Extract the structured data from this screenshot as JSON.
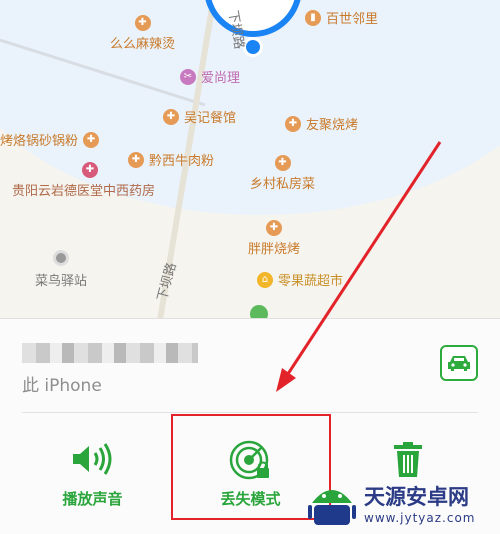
{
  "map": {
    "pois": [
      {
        "name": "百世邻里",
        "type": "food",
        "icon": "store-icon"
      },
      {
        "name": "么么麻辣烫",
        "type": "food",
        "icon": "restaurant-icon"
      },
      {
        "name": "爱尚理",
        "type": "shop",
        "icon": "salon-icon"
      },
      {
        "name": "吴记餐馆",
        "type": "food",
        "icon": "restaurant-icon"
      },
      {
        "name": "友聚烧烤",
        "type": "food",
        "icon": "restaurant-icon"
      },
      {
        "name": "烤烙锅砂锅粉",
        "type": "food",
        "icon": "restaurant-icon"
      },
      {
        "name": "黔西牛肉粉",
        "type": "food",
        "icon": "restaurant-icon"
      },
      {
        "name": "贵阳云岩德医堂中西药房",
        "type": "med",
        "icon": "pharmacy-icon"
      },
      {
        "name": "乡村私房菜",
        "type": "food",
        "icon": "restaurant-icon"
      },
      {
        "name": "菜鸟驿站",
        "type": "gray",
        "icon": "pin-icon"
      },
      {
        "name": "胖胖烧烤",
        "type": "food",
        "icon": "restaurant-icon"
      },
      {
        "name": "零果蔬超市",
        "type": "yellowshop",
        "icon": "basket-icon"
      }
    ],
    "roads": [
      "下坝路",
      "下坝路"
    ]
  },
  "sheet": {
    "device_subtitle": "此 iPhone",
    "actions": [
      {
        "label": "播放声音",
        "icon": "speaker-icon"
      },
      {
        "label": "丢失模式",
        "icon": "lost-mode-radar-icon"
      },
      {
        "label": "",
        "icon": "trash-icon"
      }
    ]
  },
  "watermark": {
    "cn": "天源安卓网",
    "en": "www.jytyaz.com"
  },
  "colors": {
    "accent": "#2aa53b",
    "highlight": "#e2232a",
    "arrow": "#e2232a",
    "location": "#1a84f5"
  }
}
